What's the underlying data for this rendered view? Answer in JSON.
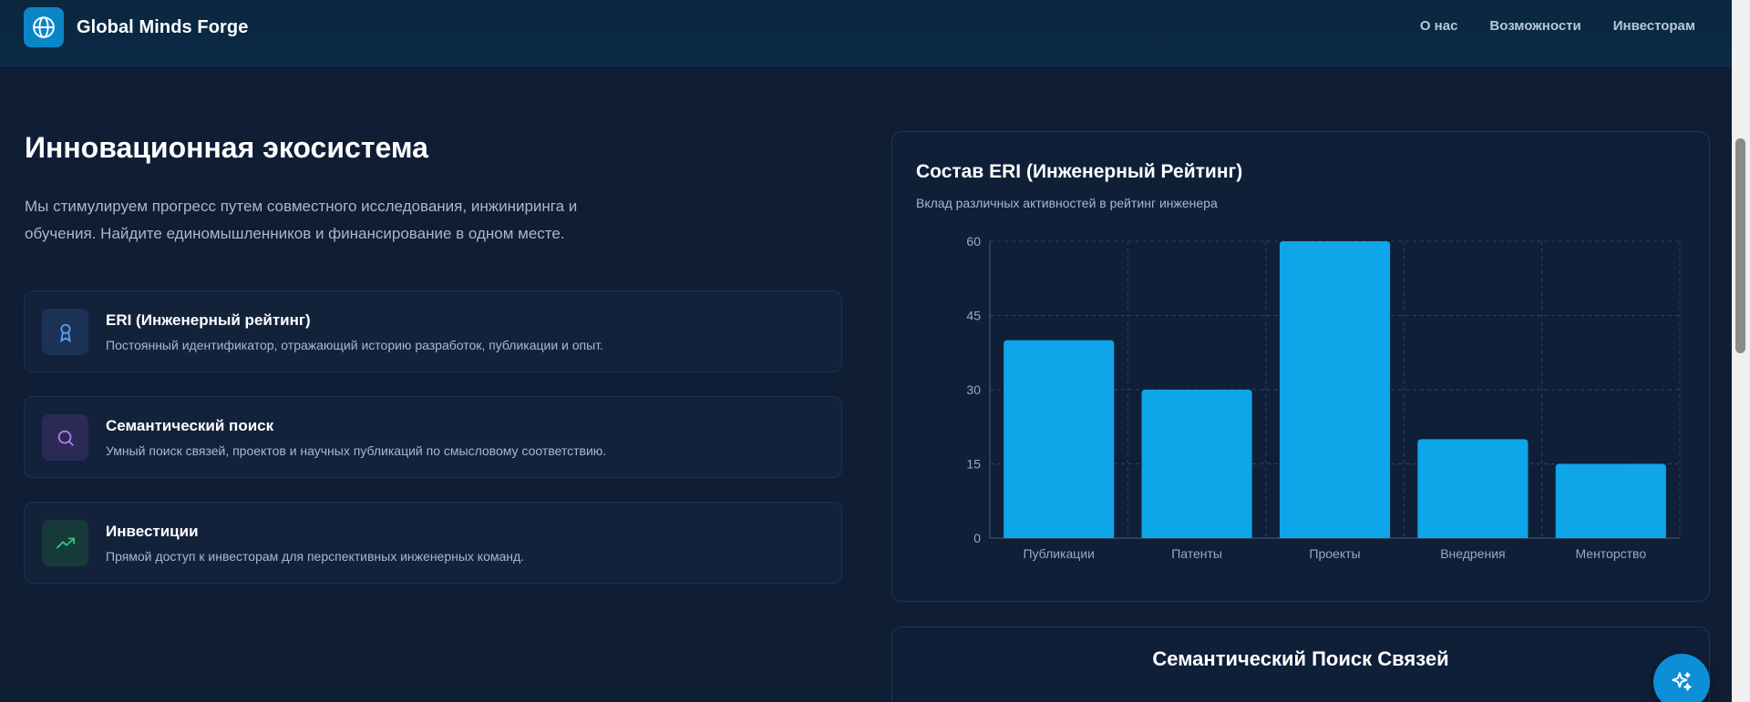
{
  "header": {
    "brand_name": "Global Minds Forge",
    "logo_icon": "globe-icon",
    "nav": [
      "О нас",
      "Возможности",
      "Инвесторам"
    ]
  },
  "hero": {
    "title": "Инновационная экосистема",
    "subtitle": "Мы стимулируем прогресс путем совместного исследования, инжиниринга и обучения. Найдите единомышленников и финансирование в одном месте."
  },
  "features": [
    {
      "title": "ERI (Инженерный рейтинг)",
      "description": "Постоянный идентификатор, отражающий историю разработок, публикации и опыт.",
      "icon": "award-icon",
      "accent": "#5b9bf0"
    },
    {
      "title": "Семантический поиск",
      "description": "Умный поиск связей, проектов и научных публикаций по смысловому соответствию.",
      "icon": "search-icon",
      "accent": "#b07cf5"
    },
    {
      "title": "Инвестиции",
      "description": "Прямой доступ к инвесторам для перспективных инженерных команд.",
      "icon": "trending-up-icon",
      "accent": "#34c27a"
    }
  ],
  "chart_card": {
    "title": "Состав ERI (Инженерный Рейтинг)",
    "subtitle": "Вклад различных активностей в рейтинг инженера"
  },
  "chart_data": {
    "type": "bar",
    "categories": [
      "Публикации",
      "Патенты",
      "Проекты",
      "Внедрения",
      "Менторство"
    ],
    "values": [
      40,
      30,
      60,
      20,
      15
    ],
    "yticks": [
      0,
      15,
      30,
      45,
      60
    ],
    "ylim": [
      0,
      60
    ],
    "grid": true,
    "bar_color": "#0ea5e9"
  },
  "search_card": {
    "title": "Семантический Поиск Связей"
  },
  "fab": {
    "icon": "sparkles-icon"
  }
}
